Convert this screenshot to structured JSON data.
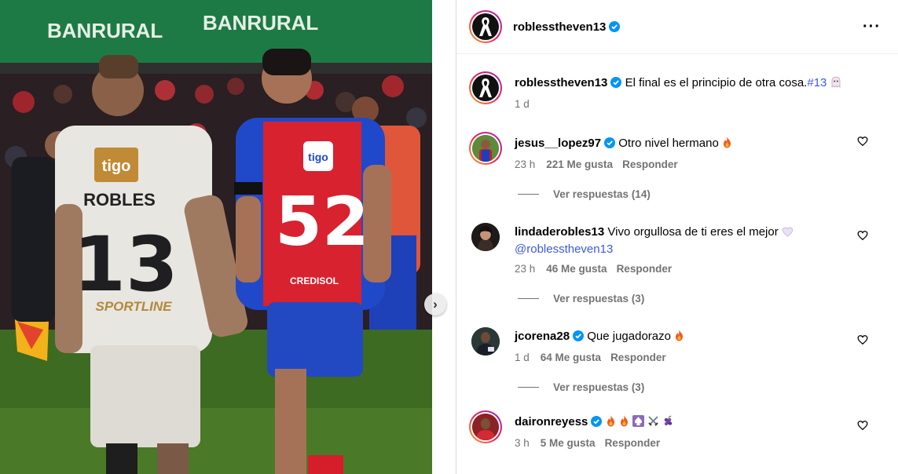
{
  "post": {
    "author": "roblesstheven13",
    "caption": "El final es el principio de otra cosa.",
    "hashtag": "#13",
    "time": "1 d"
  },
  "photo": {
    "banner_left": "BANRURAL",
    "banner_right": "BANRURAL",
    "player1_name": "ROBLES",
    "player1_number": "13",
    "player1_sponsor": "tigo",
    "player1_sponsor2": "SPORTLINE",
    "player2_number": "52",
    "player2_sponsor": "tigo",
    "player2_sponsor2": "CREDISOL"
  },
  "comments": [
    {
      "user": "jesus__lopez97",
      "verified": true,
      "text": "Otro nivel hermano",
      "emoji": "fire",
      "time": "23 h",
      "likes": "221 Me gusta",
      "reply": "Responder",
      "view_replies": "Ver respuestas (14)"
    },
    {
      "user": "lindaderobles13",
      "verified": false,
      "text": "Vivo orgullosa de ti eres el mejor",
      "mention": "@roblesstheven13",
      "emoji": "white-heart",
      "time": "23 h",
      "likes": "46 Me gusta",
      "reply": "Responder",
      "view_replies": "Ver respuestas (3)"
    },
    {
      "user": "jcorena28",
      "verified": true,
      "text": "Que jugadorazo",
      "emoji": "fire",
      "time": "1 d",
      "likes": "64 Me gusta",
      "reply": "Responder",
      "view_replies": "Ver respuestas (3)"
    },
    {
      "user": "daironreyess",
      "verified": true,
      "text": "",
      "emoji": "fire fire spade swords grapes",
      "time": "3 h",
      "likes": "5 Me gusta",
      "reply": "Responder"
    }
  ],
  "colors": {
    "link": "#3b5bdb",
    "verified": "#0095f6",
    "muted": "#737373"
  }
}
